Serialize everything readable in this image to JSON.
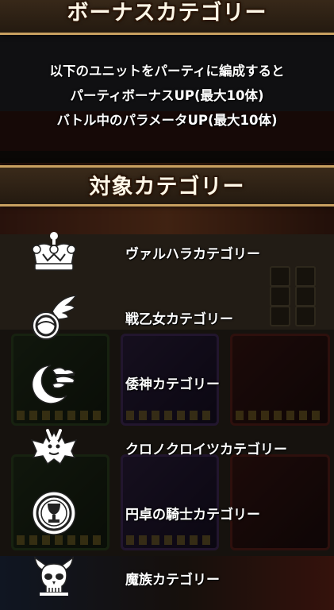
{
  "bonus_header": {
    "title": "ボーナスカテゴリー"
  },
  "description": {
    "lines": [
      "以下のユニットをパーティに編成すると",
      "パーティボーナスUP(最大10体)",
      "バトル中のパラメータUP(最大10体)"
    ]
  },
  "target_header": {
    "title": "対象カテゴリー"
  },
  "categories": [
    {
      "label": "ヴァルハラカテゴリー",
      "icon": "crown-icon"
    },
    {
      "label": "戦乙女カテゴリー",
      "icon": "winged-orb-icon"
    },
    {
      "label": "倭神カテゴリー",
      "icon": "moon-cloud-icon"
    },
    {
      "label": "クロノクロイツカテゴリー",
      "icon": "demon-wings-icon"
    },
    {
      "label": "円卓の騎士カテゴリー",
      "icon": "grail-emblem-icon"
    },
    {
      "label": "魔族カテゴリー",
      "icon": "horned-skull-icon"
    }
  ]
}
